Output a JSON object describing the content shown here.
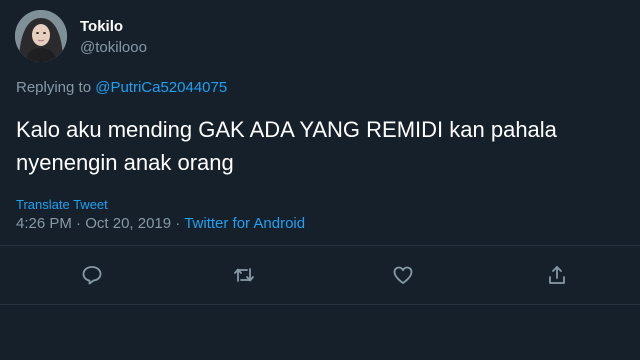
{
  "author": {
    "display_name": "Tokilo",
    "handle": "@tokilooo"
  },
  "reply": {
    "prefix": "Replying to",
    "mention": "@PutriCa52044075"
  },
  "tweet": {
    "text": "Kalo aku mending GAK ADA YANG REMIDI kan pahala nyenengin anak orang",
    "translate_label": "Translate Tweet",
    "time": "4:26 PM",
    "date": "Oct 20, 2019",
    "separator": "·",
    "source": "Twitter for Android"
  },
  "actions": [
    {
      "icon": "reply-icon"
    },
    {
      "icon": "retweet-icon"
    },
    {
      "icon": "like-icon"
    },
    {
      "icon": "share-icon"
    }
  ],
  "colors": {
    "background": "#15202b",
    "text_primary": "#ffffff",
    "text_secondary": "#8899a6",
    "accent": "#1da1f2",
    "divider": "#253341"
  }
}
